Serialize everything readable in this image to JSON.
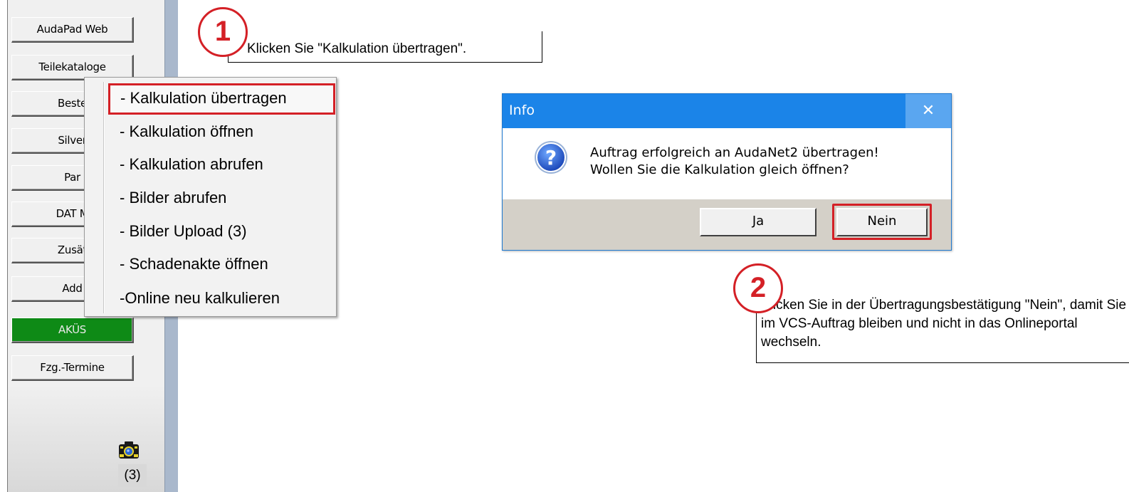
{
  "sidebar": {
    "buttons": [
      "AudaPad Web",
      "Teilekataloge",
      "Beste",
      "Silver",
      "Par",
      "DAT M",
      "Zusät",
      "Add",
      "AKÜS",
      "Fzg.-Termine"
    ],
    "photo_count": "(3)"
  },
  "context_menu": {
    "items": [
      "- Kalkulation übertragen",
      "- Kalkulation öffnen",
      "- Kalkulation abrufen",
      "- Bilder abrufen",
      "- Bilder Upload (3)",
      "- Schadenakte öffnen",
      "-Online neu kalkulieren"
    ]
  },
  "callout1": {
    "number": "1",
    "text": "Klicken Sie \"Kalkulation übertragen\"."
  },
  "callout2": {
    "number": "2",
    "text": "Klicken Sie in der Übertragungsbestätigung \"Nein\", damit Sie im VCS-Auftrag bleiben und nicht in das Onlineportal wechseln."
  },
  "dialog": {
    "title": "Info",
    "close": "✕",
    "message_line1": "Auftrag erfolgreich an AudaNet2 übertragen!",
    "message_line2": "Wollen Sie die Kalkulation gleich öffnen?",
    "yes": "Ja",
    "no": "Nein"
  },
  "colors": {
    "accent_red": "#d42026",
    "titlebar_blue": "#1b84e8",
    "akus_green": "#0e8a16"
  }
}
